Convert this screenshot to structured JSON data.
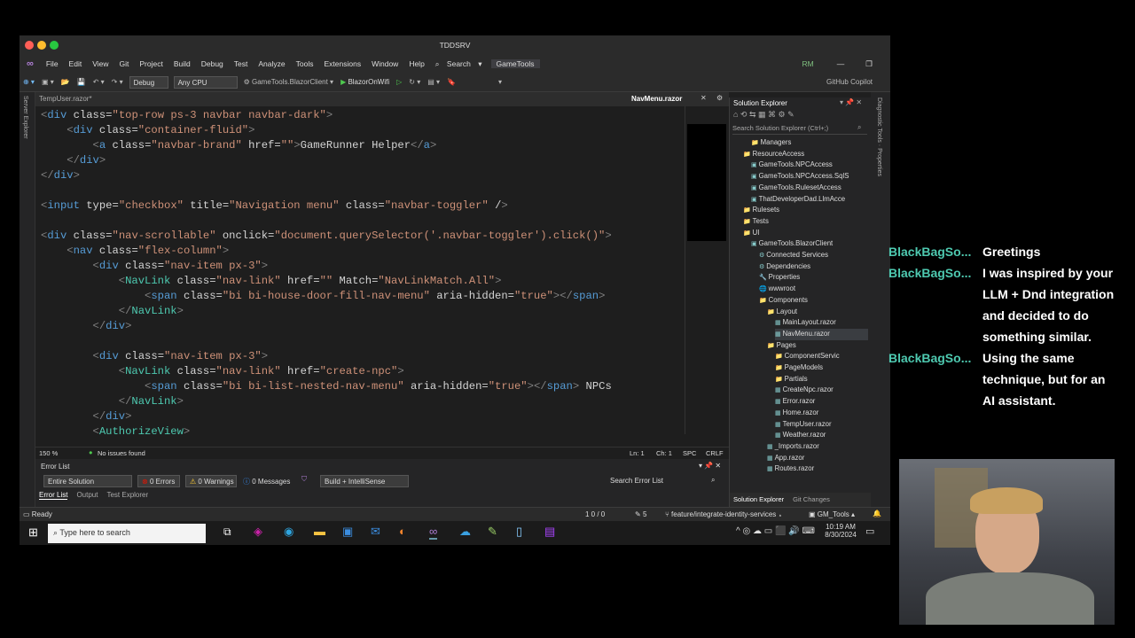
{
  "window": {
    "title": "TDDSRV"
  },
  "menu": [
    "File",
    "Edit",
    "View",
    "Git",
    "Project",
    "Build",
    "Debug",
    "Test",
    "Analyze",
    "Tools",
    "Extensions",
    "Window",
    "Help"
  ],
  "search_label": "Search",
  "solution_badge": "GameTools",
  "user_initials": "RM",
  "toolbar": {
    "config": "Debug",
    "platform": "Any CPU",
    "startup": "GameTools.BlazorClient",
    "profile": "BlazorOnWifi",
    "copilot": "GitHub Copilot"
  },
  "editor": {
    "tab_left": "TempUser.razor*",
    "tab_active": "NavMenu.razor",
    "zoom": "150 %",
    "issues": "No issues found",
    "ln": "Ln: 1",
    "ch": "Ch: 1",
    "spc": "SPC",
    "crlf": "CRLF"
  },
  "code_lines": [
    "<div class=\"top-row ps-3 navbar navbar-dark\">",
    "    <div class=\"container-fluid\">",
    "        <a class=\"navbar-brand\" href=\"\">GameRunner Helper</a>",
    "    </div>",
    "</div>",
    "",
    "<input type=\"checkbox\" title=\"Navigation menu\" class=\"navbar-toggler\" />",
    "",
    "<div class=\"nav-scrollable\" onclick=\"document.querySelector('.navbar-toggler').click()\">",
    "    <nav class=\"flex-column\">",
    "        <div class=\"nav-item px-3\">",
    "            <NavLink class=\"nav-link\" href=\"\" Match=\"NavLinkMatch.All\">",
    "                <span class=\"bi bi-house-door-fill-nav-menu\" aria-hidden=\"true\"></span>",
    "            </NavLink>",
    "        </div>",
    "",
    "        <div class=\"nav-item px-3\">",
    "            <NavLink class=\"nav-link\" href=\"create-npc\">",
    "                <span class=\"bi bi-list-nested-nav-menu\" aria-hidden=\"true\"></span> NPCs",
    "            </NavLink>",
    "        </div>",
    "        <AuthorizeView>",
    "            <Authorized>"
  ],
  "error_list": {
    "title": "Error List",
    "scope": "Entire Solution",
    "errors": "0 Errors",
    "warnings": "0 Warnings",
    "messages": "0 Messages",
    "build": "Build + IntelliSense",
    "search": "Search Error List"
  },
  "bottom_tabs": [
    "Error List",
    "Output",
    "Test Explorer"
  ],
  "status": {
    "ready": "Ready",
    "updown": "1 0 / 0",
    "pencil": "5",
    "branch": "feature/integrate-identity-services",
    "repo": "GM_Tools"
  },
  "solution_explorer": {
    "title": "Solution Explorer",
    "search": "Search Solution Explorer (Ctrl+;)",
    "items": [
      "Managers",
      "ResourceAccess",
      "GameTools.NPCAccess",
      "GameTools.NPCAccess.SqlS",
      "GameTools.RulesetAccess",
      "ThatDeveloperDad.LlmAcce",
      "Rulesets",
      "Tests",
      "UI",
      "GameTools.BlazorClient",
      "Connected Services",
      "Dependencies",
      "Properties",
      "wwwroot",
      "Components",
      "Layout",
      "MainLayout.razor",
      "NavMenu.razor",
      "Pages",
      "ComponentServic",
      "PageModels",
      "Partials",
      "CreateNpc.razor",
      "Error.razor",
      "Home.razor",
      "TempUser.razor",
      "Weather.razor",
      "_Imports.razor",
      "App.razor",
      "Routes.razor"
    ],
    "tabs": [
      "Solution Explorer",
      "Git Changes"
    ]
  },
  "taskbar": {
    "search": "Type here to search",
    "time": "10:19 AM",
    "date": "8/30/2024"
  },
  "chat": [
    {
      "user": "BlackBagSo...",
      "lines": [
        "Greetings"
      ]
    },
    {
      "user": "BlackBagSo...",
      "lines": [
        "I was inspired by your",
        "LLM + Dnd integration",
        "and decided to do",
        "something similar."
      ]
    },
    {
      "user": "BlackBagSo...",
      "lines": [
        "Using the same",
        "technique, but for an",
        "AI assistant."
      ]
    }
  ]
}
